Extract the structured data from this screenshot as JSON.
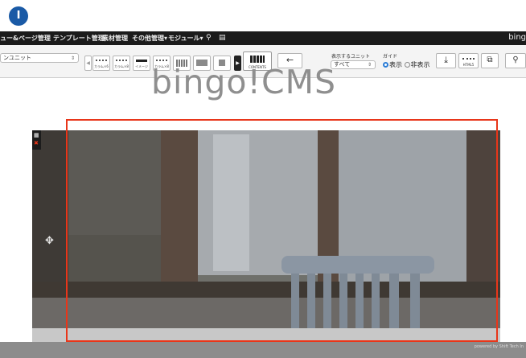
{
  "marker": {
    "label": "I"
  },
  "menubar": {
    "items": [
      "ュー&ページ管理",
      "テンプレート管理",
      "素材管理",
      "その他管理▾",
      "モジュール▾"
    ],
    "brand": "bing",
    "colors": {
      "background": "#1b1b1b",
      "text": "#eeeeee"
    }
  },
  "toolbar": {
    "unit_select": "ンユニット",
    "layout_buttons": [
      {
        "label": "カラム×6"
      },
      {
        "label": "カラム×8"
      },
      {
        "label": "イメージ"
      },
      {
        "label": "カラム×8"
      }
    ],
    "contents_label": "CONTENTS",
    "display_unit_label": "表示するユニット",
    "display_unit_value": "すべて",
    "guide_label": "ガイド",
    "guide_options": [
      "表示",
      "非表示"
    ],
    "guide_selected": "表示",
    "right_buttons": [
      {
        "icon": "download-icon"
      },
      {
        "label": "HTML5"
      },
      {
        "icon": "copy-icon"
      },
      {
        "icon": "user-search-icon"
      }
    ]
  },
  "page": {
    "logo_text": "bingo!CMS",
    "footer_text": "powered by Shift Tech In"
  },
  "colors": {
    "highlight": "#e8361a",
    "accent": "#2a7cd6",
    "marker": "#1a5aa6"
  }
}
